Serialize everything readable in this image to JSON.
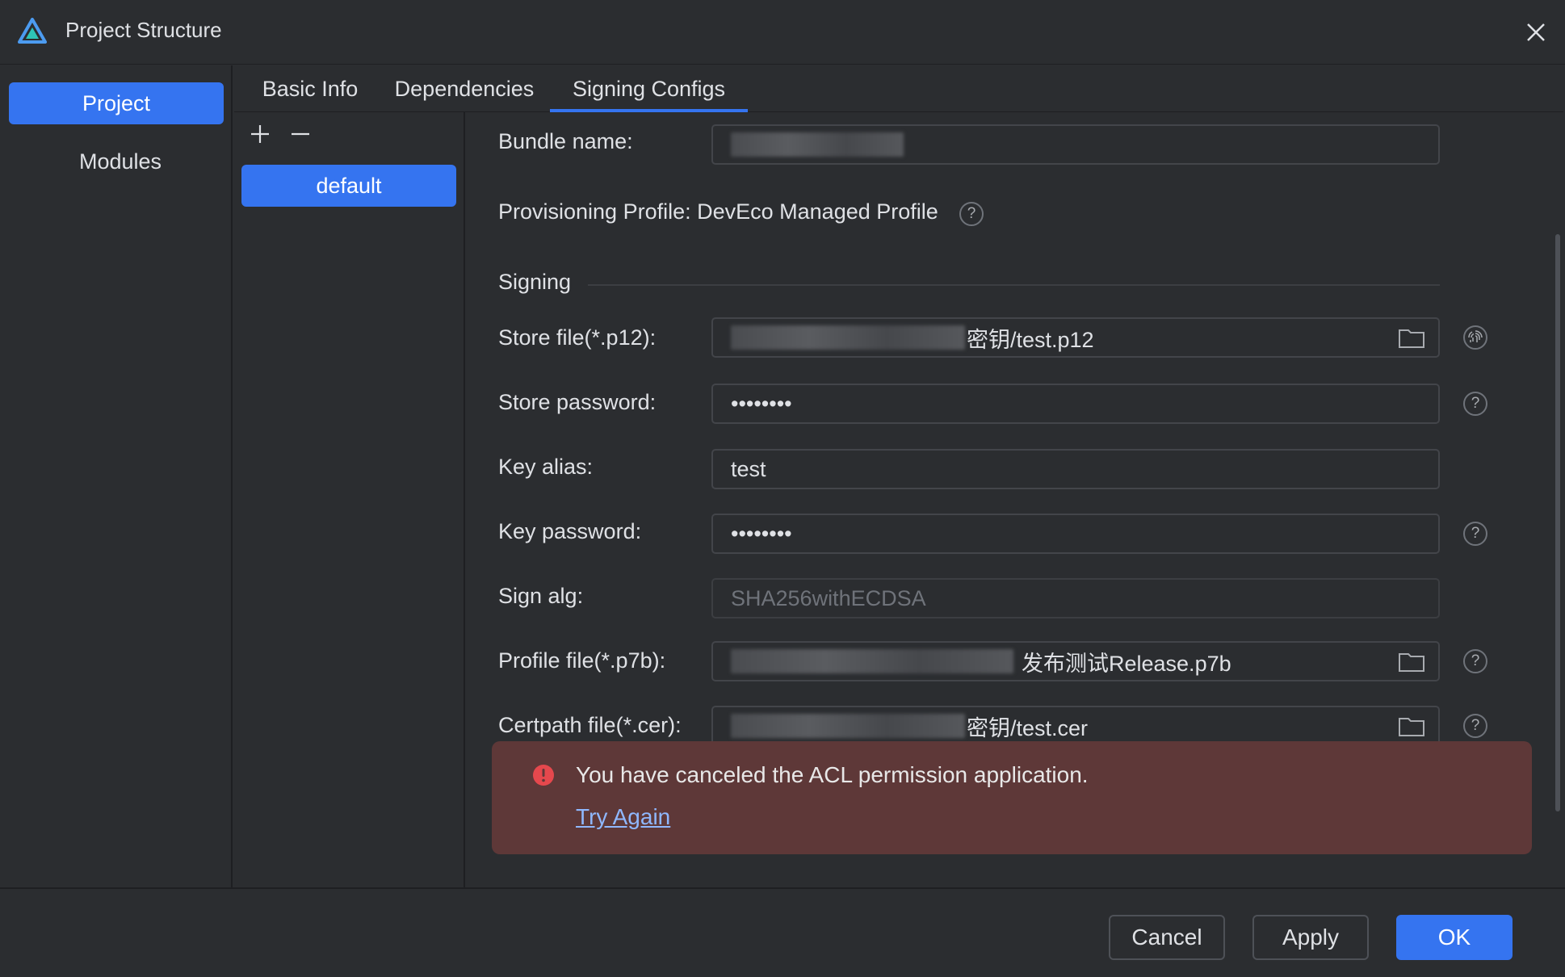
{
  "window": {
    "title": "Project Structure"
  },
  "nav": {
    "items": [
      "Project",
      "Modules"
    ],
    "selected": "Project"
  },
  "tabs": [
    "Basic Info",
    "Dependencies",
    "Signing Configs"
  ],
  "active_tab": "Signing Configs",
  "config_list": {
    "add": "+",
    "remove": "—",
    "items": [
      "default"
    ]
  },
  "form": {
    "bundle_name": {
      "label": "Bundle name:",
      "value": ""
    },
    "provisioning_profile": "Provisioning Profile: DevEco Managed Profile",
    "section_signing": "Signing",
    "store_file": {
      "label": "Store file(*.p12):",
      "value": "密钥/test.p12"
    },
    "store_password": {
      "label": "Store password:",
      "value": "••••••••"
    },
    "key_alias": {
      "label": "Key alias:",
      "value": "test"
    },
    "key_password": {
      "label": "Key password:",
      "value": "••••••••"
    },
    "sign_alg": {
      "label": "Sign alg:",
      "value": "SHA256withECDSA"
    },
    "profile_file": {
      "label": "Profile file(*.p7b):",
      "value": "发布测试Release.p7b"
    },
    "certpath_file": {
      "label": "Certpath file(*.cer):",
      "value": "密钥/test.cer"
    },
    "help_glyph": "?"
  },
  "toast": {
    "message": "You have canceled the ACL permission application.",
    "link": "Try Again",
    "color": "#5e3838"
  },
  "footer": {
    "cancel": "Cancel",
    "apply": "Apply",
    "ok": "OK"
  },
  "colors": {
    "accent": "#3574f0",
    "background": "#2b2d30",
    "error": "#e5484d"
  }
}
